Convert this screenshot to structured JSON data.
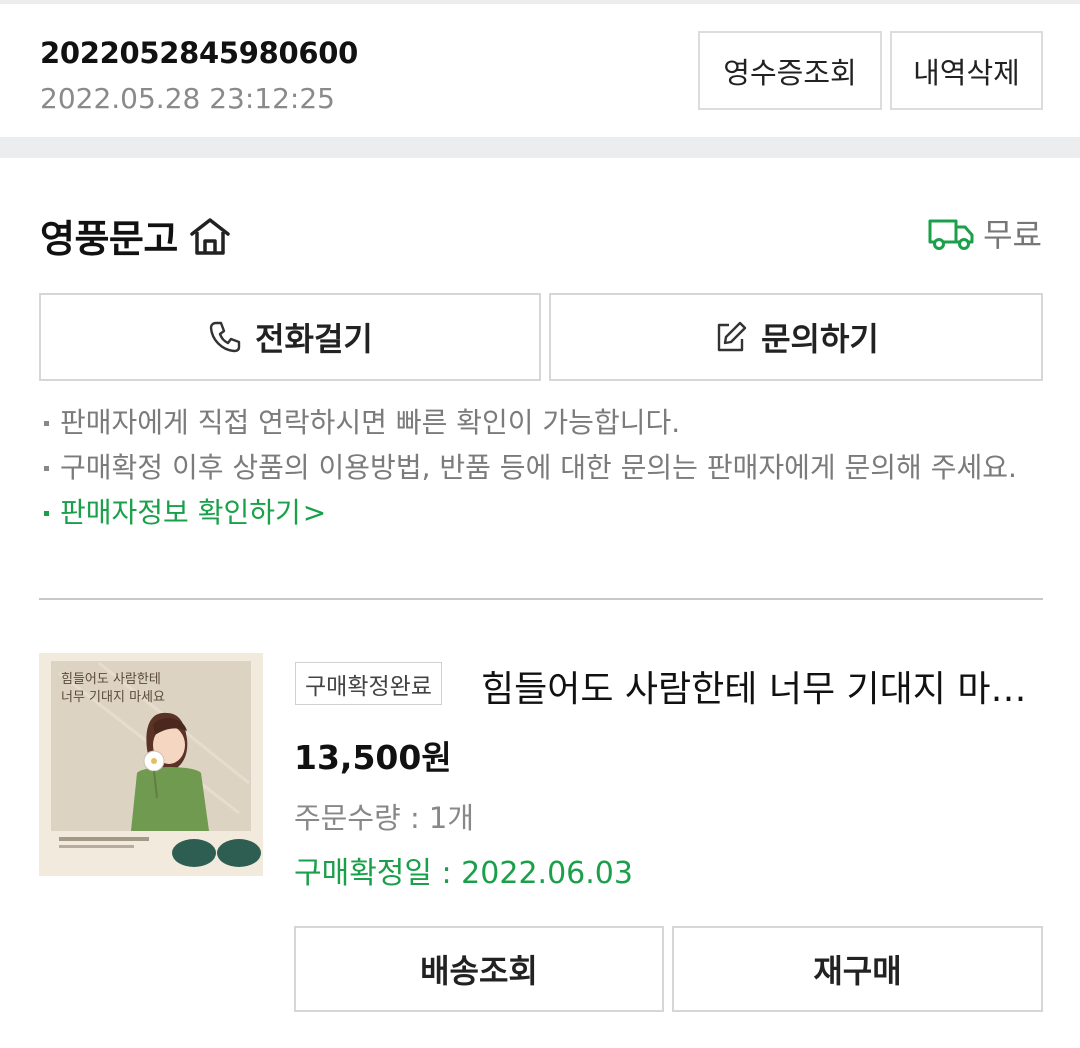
{
  "order": {
    "number": "2022052845980600",
    "datetime": "2022.05.28 23:12:25",
    "receipt_label": "영수증조회",
    "delete_label": "내역삭제"
  },
  "seller": {
    "name": "영풍문고",
    "shipping_label": "무료",
    "call_label": "전화걸기",
    "inquiry_label": "문의하기",
    "notes": [
      "판매자에게 직접 연락하시면 빠른 확인이 가능합니다.",
      "구매확정 이후 상품의 이용방법, 반품 등에 대한 문의는 판매자에게 문의해 주세요."
    ],
    "info_link": "판매자정보 확인하기",
    "info_link_chevron": ">"
  },
  "product": {
    "status": "구매확정완료",
    "title": "힘들어도 사람한테 너무 기대지 마세요",
    "price": "13,500원",
    "quantity": "주문수량 : 1개",
    "confirm_date": "구매확정일 : 2022.06.03",
    "cover_title_line1": "힘들어도 사람한테",
    "cover_title_line2": "너무 기대지 마세요"
  },
  "actions": {
    "track_label": "배송조회",
    "rebuy_label": "재구매"
  },
  "colors": {
    "accent_green": "#1aa04a",
    "border": "#d6d6d6",
    "band": "#ebedef"
  }
}
